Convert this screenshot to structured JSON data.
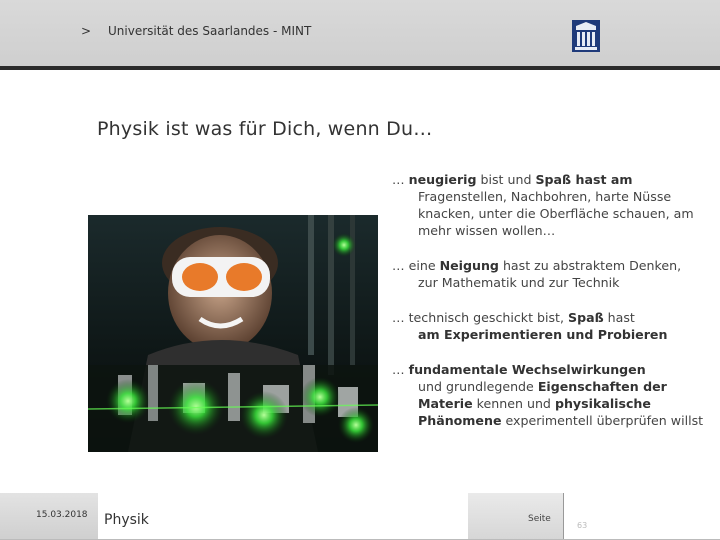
{
  "header": {
    "arrow": ">",
    "title": "Universität des Saarlandes - MINT"
  },
  "slide": {
    "title": "Physik ist was für Dich, wenn Du…"
  },
  "bullets": [
    {
      "lead": "… ",
      "b1": "neugierig",
      "t1": " bist und ",
      "b2": "Spaß hast am",
      "rest": "Fragenstellen, Nachbohren, harte Nüsse knacken, unter die Oberfläche schauen, am mehr wissen wollen…"
    },
    {
      "lead": "… eine ",
      "b1": "Neigung",
      "t1": " hast zu abstraktem Denken,",
      "rest": "zur Mathematik und zur Technik"
    },
    {
      "lead": "… technisch geschickt bist, ",
      "b1": "Spaß",
      "t1": " hast",
      "rest_b": "am Experimentieren und Probieren"
    },
    {
      "lead": "… ",
      "b1": "fundamentale Wechselwirkungen",
      "r1": "und grundlegende ",
      "r1b": "Eigenschaften der Materie",
      "r2": " kennen und ",
      "r2b": "physikalische Phänomene",
      "r3": " experimentell überprüfen willst"
    }
  ],
  "footer": {
    "date": "15.03.2018",
    "topic": "Physik",
    "seite_label": "Seite",
    "page_number": "63"
  },
  "colors": {
    "header_bg": "#d6d6d6",
    "header_rule": "#2b2b2b",
    "laser_green": "#33ff33",
    "goggles_lens": "#e87a2a"
  },
  "icons": {
    "logo": "university-seal-icon",
    "photo": "laser-lab-photo"
  }
}
